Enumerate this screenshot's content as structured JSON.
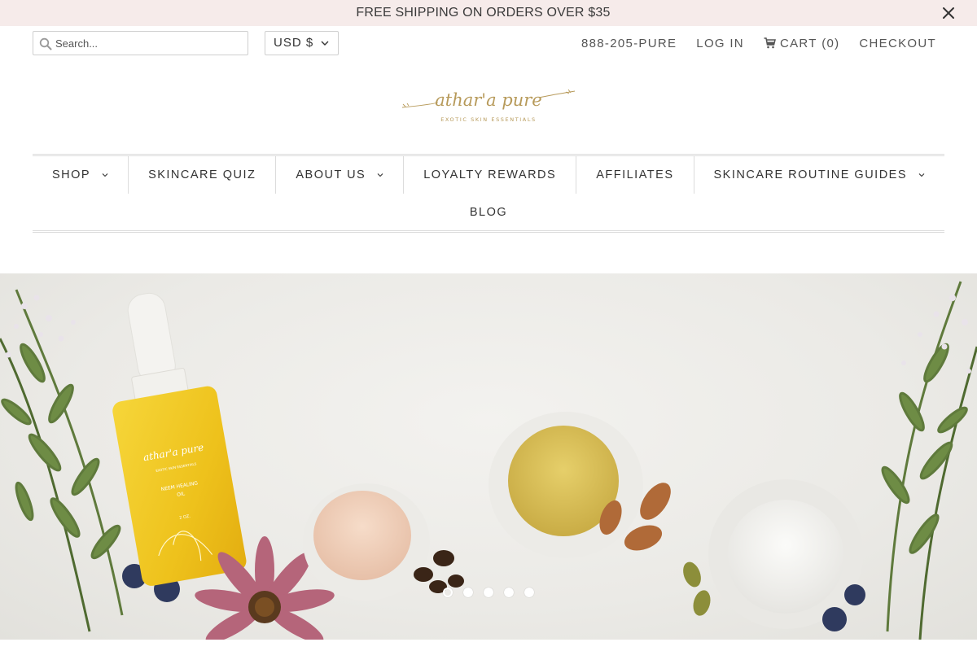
{
  "announcement": {
    "text": "FREE SHIPPING ON ORDERS OVER $35",
    "close_icon": "close-icon"
  },
  "header": {
    "search_placeholder": "Search...",
    "currency": "USD $",
    "phone": "888-205-PURE",
    "login": "LOG IN",
    "cart_label": "CART",
    "cart_count": "(0)",
    "checkout": "CHECKOUT"
  },
  "logo": {
    "name": "athar'a pure",
    "tagline": "EXOTIC SKIN ESSENTIALS",
    "color": "#b79a5a"
  },
  "nav": {
    "items": [
      {
        "label": "SHOP",
        "has_dropdown": true
      },
      {
        "label": "SKINCARE QUIZ",
        "has_dropdown": false
      },
      {
        "label": "ABOUT US",
        "has_dropdown": true
      },
      {
        "label": "LOYALTY REWARDS",
        "has_dropdown": false
      },
      {
        "label": "AFFILIATES",
        "has_dropdown": false
      },
      {
        "label": "SKINCARE ROUTINE GUIDES",
        "has_dropdown": true
      }
    ],
    "second_row": [
      {
        "label": "BLOG",
        "has_dropdown": false
      }
    ]
  },
  "hero": {
    "bottle_brand": "athar'a pure",
    "bottle_subtitle": "EXOTIC SKIN ESSENTIALS",
    "bottle_product": "NEEM HEALING OIL",
    "bottle_size": "2 OZ.",
    "slides": 5,
    "active_slide": 1
  },
  "colors": {
    "announcement_bg": "#f6ebea",
    "text": "#333333",
    "logo_gold": "#b79a5a"
  }
}
